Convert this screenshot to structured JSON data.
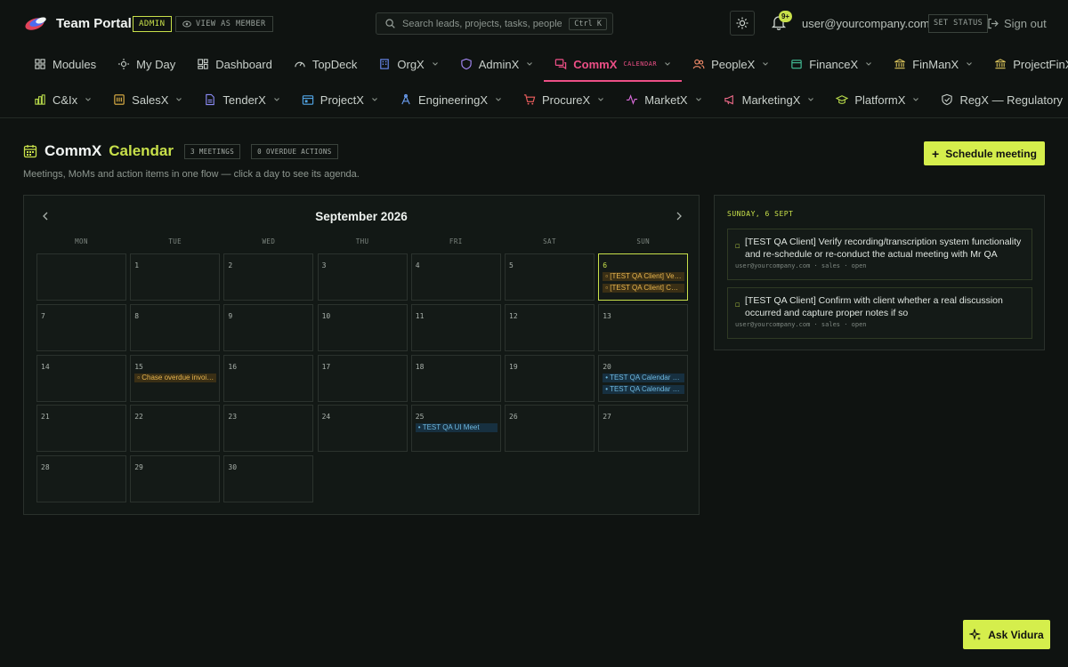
{
  "app": {
    "title": "Team Portal",
    "admin_badge": "ADMIN",
    "view_as_member": "VIEW AS MEMBER"
  },
  "search": {
    "placeholder": "Search leads, projects, tasks, people…",
    "shortcut": "Ctrl K"
  },
  "header": {
    "notifications_count": "9+",
    "user_email": "user@yourcompany.com",
    "set_status": "SET STATUS",
    "sign_out": "Sign out"
  },
  "nav_row1": [
    {
      "label": "Modules",
      "icon": "grid-icon",
      "chevron": false
    },
    {
      "label": "My Day",
      "icon": "sun-icon",
      "chevron": false
    },
    {
      "label": "Dashboard",
      "icon": "dashboard-icon",
      "chevron": false
    },
    {
      "label": "TopDeck",
      "icon": "gauge-icon",
      "chevron": false
    },
    {
      "label": "OrgX",
      "icon": "building-icon",
      "chevron": true
    },
    {
      "label": "AdminX",
      "icon": "shield-icon",
      "chevron": true
    },
    {
      "label": "CommX",
      "icon": "chat-icon",
      "chevron": true,
      "active": true,
      "sub": "CALENDAR"
    },
    {
      "label": "PeopleX",
      "icon": "people-icon",
      "chevron": true
    },
    {
      "label": "FinanceX",
      "icon": "wallet-icon",
      "chevron": true
    },
    {
      "label": "FinManX",
      "icon": "bank-icon",
      "chevron": true
    },
    {
      "label": "ProjectFinX",
      "icon": "bank-icon",
      "chevron": true
    }
  ],
  "nav_row2": [
    {
      "label": "C&Ix",
      "icon": "chart-icon",
      "chevron": true
    },
    {
      "label": "SalesX",
      "icon": "sales-icon",
      "chevron": true
    },
    {
      "label": "TenderX",
      "icon": "document-icon",
      "chevron": true
    },
    {
      "label": "ProjectX",
      "icon": "project-icon",
      "chevron": true
    },
    {
      "label": "EngineeringX",
      "icon": "engineer-icon",
      "chevron": true
    },
    {
      "label": "ProcureX",
      "icon": "cart-icon",
      "chevron": true
    },
    {
      "label": "MarketX",
      "icon": "pulse-icon",
      "chevron": true
    },
    {
      "label": "MarketingX",
      "icon": "megaphone-icon",
      "chevron": true
    },
    {
      "label": "PlatformX",
      "icon": "graduation-icon",
      "chevron": true
    },
    {
      "label": "RegX — Regulatory",
      "icon": "shield-check-icon",
      "chevron": false
    }
  ],
  "page": {
    "title_a": "CommX",
    "title_b": "Calendar",
    "meetings_pill": "3 MEETINGS",
    "overdue_pill": "0 OVERDUE ACTIONS",
    "subtitle": "Meetings, MoMs and action items in one flow — click a day to see its agenda.",
    "schedule_button": "Schedule meeting"
  },
  "calendar": {
    "month_label": "September 2026",
    "weekdays": [
      "MON",
      "TUE",
      "WED",
      "THU",
      "FRI",
      "SAT",
      "SUN"
    ],
    "first_weekday_index": 1,
    "days_in_month": 30,
    "selected_day": 6,
    "events": {
      "6": [
        {
          "text": "[TEST QA Client] Veri…",
          "kind": "orange"
        },
        {
          "text": "[TEST QA Client] Con…",
          "kind": "orange"
        }
      ],
      "15": [
        {
          "text": "Chase overdue invoic…",
          "kind": "orange"
        }
      ],
      "20": [
        {
          "text": "TEST QA Calendar M…",
          "kind": "blue"
        },
        {
          "text": "TEST QA Calendar M…",
          "kind": "blue"
        }
      ],
      "25": [
        {
          "text": "TEST QA UI Meet",
          "kind": "blue"
        }
      ]
    }
  },
  "agenda": {
    "date_label": "SUNDAY, 6 SEPT",
    "items": [
      {
        "tag": "☐",
        "text": "[TEST QA Client] Verify recording/transcription system functionality and re-schedule or re-conduct the actual meeting with Mr QA",
        "meta": "user@yourcompany.com · sales · open"
      },
      {
        "tag": "☐",
        "text": "[TEST QA Client] Confirm with client whether a real discussion occurred and capture proper notes if so",
        "meta": "user@yourcompany.com · sales · open"
      }
    ]
  },
  "assistant": {
    "label": "Ask Vidura"
  },
  "colors": {
    "accent": "#d5ee4c",
    "active_nav": "#ec4f86",
    "event_orange": "#e7b54e",
    "event_blue": "#6fb9df",
    "background": "#0f1311"
  }
}
